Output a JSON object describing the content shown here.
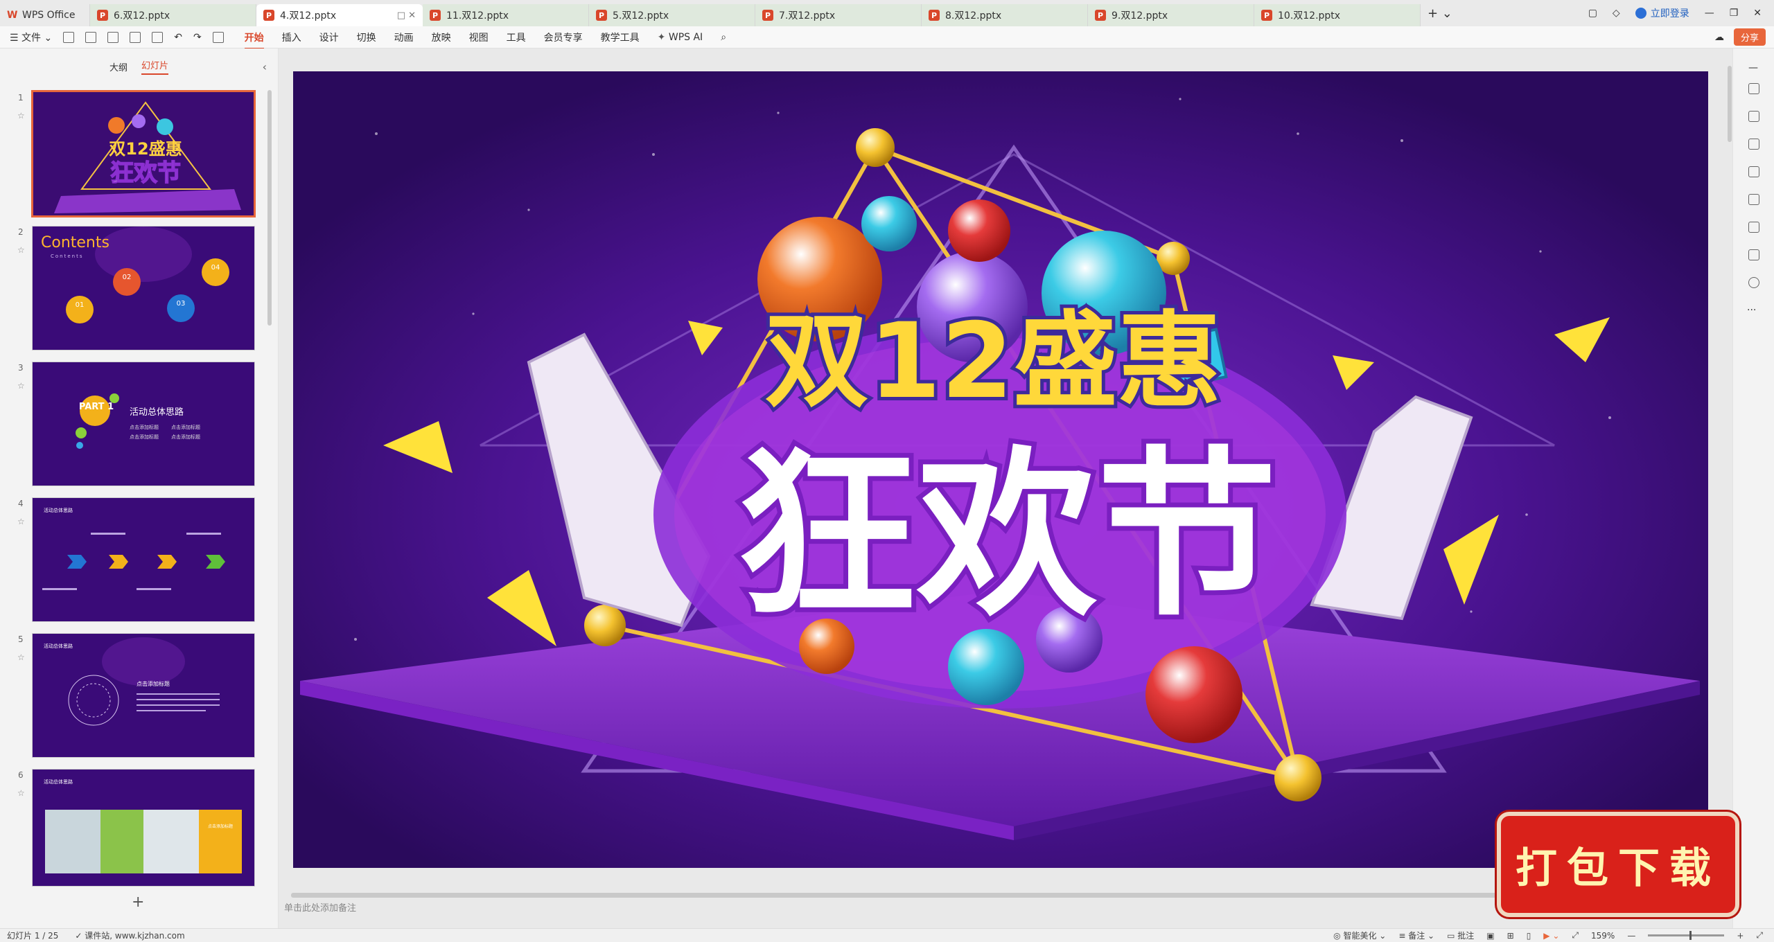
{
  "app": {
    "home_tab": "WPS Office",
    "tabs": [
      {
        "label": "6.双12.pptx",
        "active": false
      },
      {
        "label": "4.双12.pptx",
        "active": true
      },
      {
        "label": "11.双12.pptx",
        "active": false
      },
      {
        "label": "5.双12.pptx",
        "active": false
      },
      {
        "label": "7.双12.pptx",
        "active": false
      },
      {
        "label": "8.双12.pptx",
        "active": false
      },
      {
        "label": "9.双12.pptx",
        "active": false
      },
      {
        "label": "10.双12.pptx",
        "active": false
      }
    ],
    "login_label": "立即登录",
    "share_label": "分享"
  },
  "toolbar": {
    "file_label": "文件",
    "menu": [
      "开始",
      "插入",
      "设计",
      "切换",
      "动画",
      "放映",
      "视图",
      "工具",
      "会员专享",
      "教学工具"
    ],
    "wps_ai_label": "WPS AI"
  },
  "leftpanel": {
    "tab_outline": "大纲",
    "tab_slides": "幻灯片",
    "slides": [
      {
        "num": "1"
      },
      {
        "num": "2",
        "title": "Contents",
        "subtitle": "Contents",
        "items": [
          "01",
          "02",
          "03",
          "04"
        ]
      },
      {
        "num": "3",
        "badge": "PART 1",
        "title": "活动总体思路",
        "lines": [
          "点击添加标题",
          "点击添加标题",
          "点击添加标题",
          "点击添加标题"
        ]
      },
      {
        "num": "4",
        "title": "活动总体思路"
      },
      {
        "num": "5",
        "title": "活动总体思路",
        "subtitle": "点击添加标题"
      },
      {
        "num": "6",
        "title": "活动总体思路",
        "subtitle": "点击添加标题"
      }
    ]
  },
  "slide": {
    "line1": "双12盛惠",
    "line2": "狂欢节"
  },
  "notes_placeholder": "单击此处添加备注",
  "status": {
    "slide_counter": "幻灯片 1 / 25",
    "site_label": "课件站, www.kjzhan.com",
    "beautify": "智能美化",
    "notes_btn": "备注",
    "comment_btn": "批注",
    "zoom": "159%"
  },
  "badge_text": "打包下载",
  "colors": {
    "accent": "#d9472b",
    "slide_bg": "#3b0c72",
    "badge_red": "#d9211a"
  }
}
